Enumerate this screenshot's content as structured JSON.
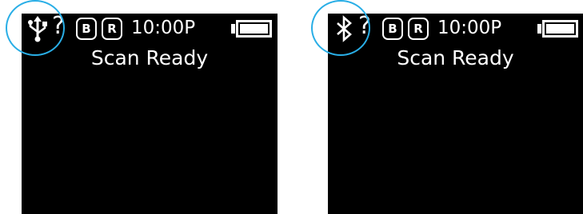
{
  "screens": [
    {
      "connection_icon": "usb-icon",
      "unknown_mark": "?",
      "mode_b": "B",
      "mode_r": "R",
      "time": "10:00P",
      "battery_icon": "battery-icon",
      "status": "Scan Ready"
    },
    {
      "connection_icon": "bluetooth-icon",
      "unknown_mark": "?",
      "mode_b": "B",
      "mode_r": "R",
      "time": "10:00P",
      "battery_icon": "battery-icon",
      "status": "Scan Ready"
    }
  ],
  "colors": {
    "screen_background": "#000000",
    "screen_text": "#ffffff",
    "callout_circle": "#29aee6",
    "page_background": "#ffffff"
  }
}
